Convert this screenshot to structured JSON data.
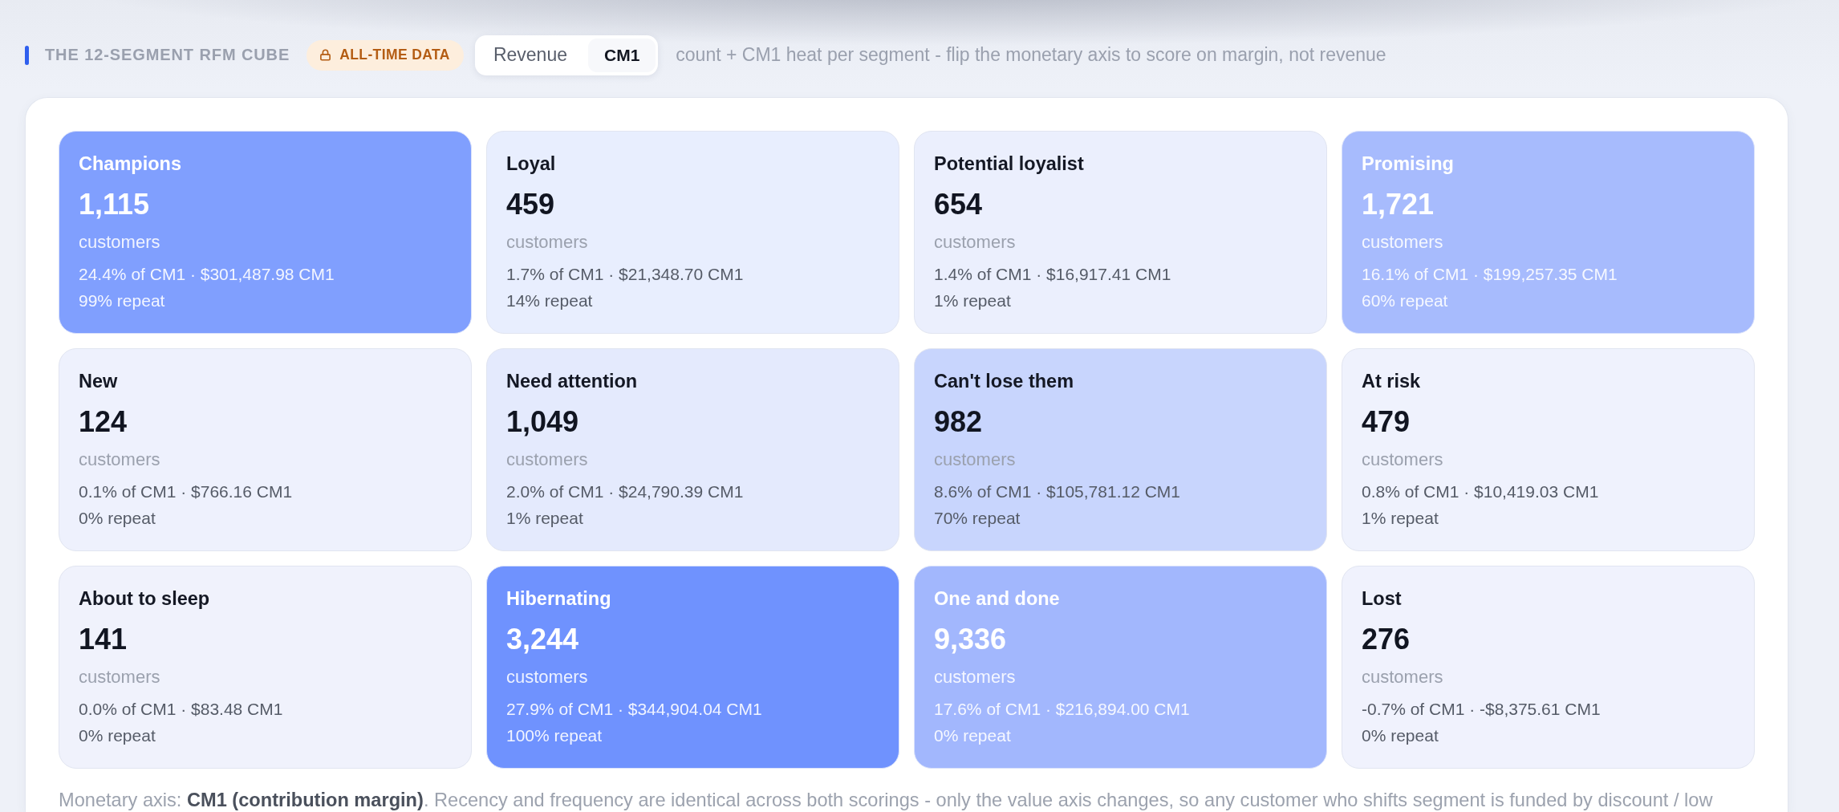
{
  "section": {
    "title": "THE 12-SEGMENT RFM CUBE",
    "badge": "ALL-TIME DATA",
    "toggle": [
      {
        "label": "Revenue",
        "selected": false
      },
      {
        "label": "CM1",
        "selected": true
      }
    ],
    "description": "count + CM1 heat per segment - flip the monetary axis to score on margin, not revenue"
  },
  "segments": [
    {
      "name": "Champions",
      "count": "1,115",
      "unit": "customers",
      "share": "24.4% of CM1 · $301,487.98 CM1",
      "repeat": "99% repeat",
      "color": "#809ffe"
    },
    {
      "name": "Loyal",
      "count": "459",
      "unit": "customers",
      "share": "1.7% of CM1 · $21,348.70 CM1",
      "repeat": "14% repeat",
      "color": "#e8eefe"
    },
    {
      "name": "Potential loyalist",
      "count": "654",
      "unit": "customers",
      "share": "1.4% of CM1 · $16,917.41 CM1",
      "repeat": "1% repeat",
      "color": "#ebeffd"
    },
    {
      "name": "Promising",
      "count": "1,721",
      "unit": "customers",
      "share": "16.1% of CM1 · $199,257.35 CM1",
      "repeat": "60% repeat",
      "color": "#a7bbfd"
    },
    {
      "name": "New",
      "count": "124",
      "unit": "customers",
      "share": "0.1% of CM1 · $766.16 CM1",
      "repeat": "0% repeat",
      "color": "#eef1fd"
    },
    {
      "name": "Need attention",
      "count": "1,049",
      "unit": "customers",
      "share": "2.0% of CM1 · $24,790.39 CM1",
      "repeat": "1% repeat",
      "color": "#e4eafd"
    },
    {
      "name": "Can't lose them",
      "count": "982",
      "unit": "customers",
      "share": "8.6% of CM1 · $105,781.12 CM1",
      "repeat": "70% repeat",
      "color": "#c8d5fd"
    },
    {
      "name": "At risk",
      "count": "479",
      "unit": "customers",
      "share": "0.8% of CM1 · $10,419.03 CM1",
      "repeat": "1% repeat",
      "color": "#eff2fd"
    },
    {
      "name": "About to sleep",
      "count": "141",
      "unit": "customers",
      "share": "0.0% of CM1 · $83.48 CM1",
      "repeat": "0% repeat",
      "color": "#f0f2fc"
    },
    {
      "name": "Hibernating",
      "count": "3,244",
      "unit": "customers",
      "share": "27.9% of CM1 · $344,904.04 CM1",
      "repeat": "100% repeat",
      "color": "#6f92fe"
    },
    {
      "name": "One and done",
      "count": "9,336",
      "unit": "customers",
      "share": "17.6% of CM1 · $216,894.00 CM1",
      "repeat": "0% repeat",
      "color": "#a2b7fd"
    },
    {
      "name": "Lost",
      "count": "276",
      "unit": "customers",
      "share": "-0.7% of CM1 · -$8,375.61 CM1",
      "repeat": "0% repeat",
      "color": "#f0f2fd"
    }
  ],
  "footnote": "Monetary axis: **CM1 (contribution margin)**. Recency and frequency are identical across both scorings - only the value axis changes, so any customer who shifts segment is funded by discount / low"
}
